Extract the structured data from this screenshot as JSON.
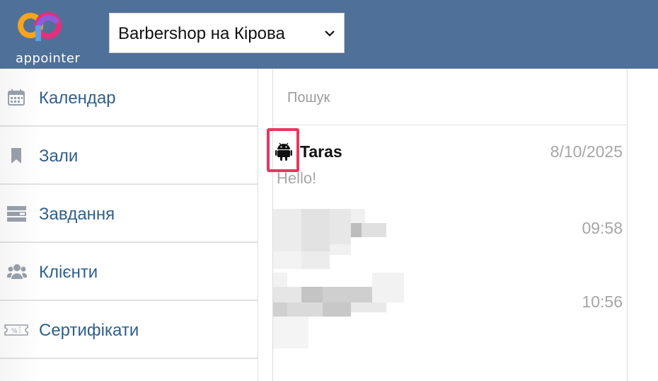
{
  "app": {
    "logo_text": "appointer"
  },
  "location_select": {
    "value": "Barbershop на Кірова"
  },
  "sidebar": {
    "items": [
      {
        "label": "Календар",
        "icon": "calendar-icon"
      },
      {
        "label": "Зали",
        "icon": "bookmark-icon"
      },
      {
        "label": "Завдання",
        "icon": "tasks-icon"
      },
      {
        "label": "Клієнти",
        "icon": "users-icon"
      },
      {
        "label": "Сертифікати",
        "icon": "ticket-icon"
      }
    ]
  },
  "chat": {
    "search": {
      "placeholder": "Пошук"
    },
    "conversations": [
      {
        "name": "Taras",
        "date": "8/10/2025",
        "message": "Hello!",
        "platform_icon": "android-icon"
      },
      {
        "name": "",
        "time": "09:58"
      },
      {
        "name": "",
        "time": "10:56"
      }
    ]
  },
  "colors": {
    "topbar": "#4f7099",
    "accent_text": "#2f5f8c",
    "highlight": "#e8365f"
  }
}
